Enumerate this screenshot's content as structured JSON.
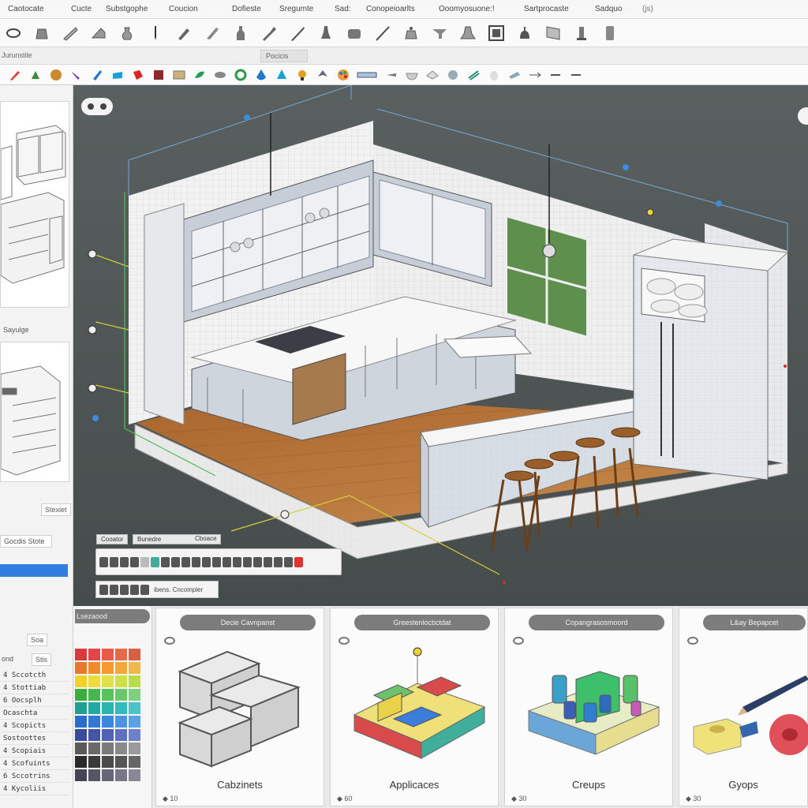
{
  "menu": [
    "Caotocate",
    "Cucte",
    "Substgophe",
    "Coucion",
    "Dofieste",
    "Sregumte",
    "Sad:",
    "Conopeioarlts",
    "Ooomyosuone:!",
    "Sartprocaste",
    "Sadquo"
  ],
  "menu_extra": "(js)",
  "strip": {
    "left": "Jurunstile",
    "tab": "Pocicis"
  },
  "left_panel": {
    "label1": "Sayulge",
    "button1": "Stexiet",
    "button2": "Gocdis Stote",
    "button3": "Soa",
    "button4": "Stis",
    "label2": "ond",
    "list": [
      "4 Sccotcth",
      "4 Stottiab",
      "6 Oocsplh",
      "Ocaschta",
      "4 Scopicts",
      "Sostoottes",
      "4 Scopiais",
      "4 Scofuints",
      "6 Sccotrins",
      "4 Kycoliis"
    ]
  },
  "viewport": {
    "tab1": "Cooator",
    "tab2": "Bunedre",
    "tab3": "Cboace",
    "toolbar2_text": "ibens. Cncompler"
  },
  "cards": [
    {
      "header": "Decie Cavnpanst",
      "title": "Cabzinets",
      "count": "10"
    },
    {
      "header": "Greestenlocbctdat",
      "title": "Applicaces",
      "count": "60"
    },
    {
      "header": "Copangrasosmoord",
      "title": "Creups",
      "count": "30"
    },
    {
      "header": "L&ay Bepapcet",
      "title": "Gyops",
      "count": "30"
    }
  ],
  "swatch_header": "Lsezaood",
  "colors": {
    "accent": "#2f7ee0",
    "viewport": "#525958",
    "wood": "#b8773e",
    "card_head": "#7c7c7c"
  }
}
